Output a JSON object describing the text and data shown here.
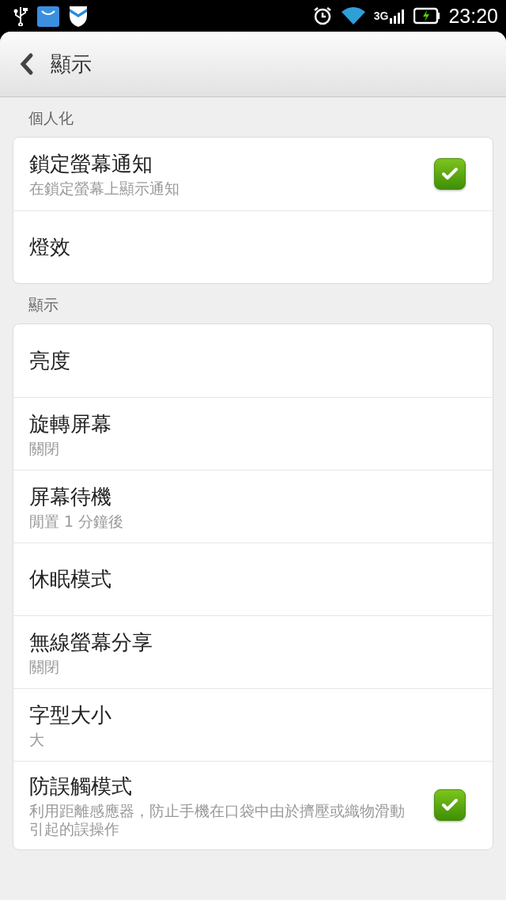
{
  "status_bar": {
    "network": "3G",
    "time": "23:20"
  },
  "header": {
    "title": "顯示"
  },
  "sections": [
    {
      "title": "個人化",
      "items": [
        {
          "kind": "checkbox",
          "title": "鎖定螢幕通知",
          "subtitle": "在鎖定螢幕上顯示通知",
          "checked": true
        },
        {
          "kind": "plain",
          "title": "燈效"
        }
      ]
    },
    {
      "title": "顯示",
      "items": [
        {
          "kind": "plain",
          "title": "亮度"
        },
        {
          "kind": "plain",
          "title": "旋轉屏幕",
          "subtitle": "關閉"
        },
        {
          "kind": "plain",
          "title": "屏幕待機",
          "subtitle": "閒置 1 分鐘後"
        },
        {
          "kind": "plain",
          "title": "休眠模式"
        },
        {
          "kind": "plain",
          "title": "無線螢幕分享",
          "subtitle": "關閉"
        },
        {
          "kind": "plain",
          "title": "字型大小",
          "subtitle": "大"
        },
        {
          "kind": "checkbox",
          "title": "防誤觸模式",
          "subtitle": "利用距離感應器，防止手機在口袋中由於擠壓或織物滑動引起的誤操作",
          "checked": true
        }
      ]
    }
  ]
}
